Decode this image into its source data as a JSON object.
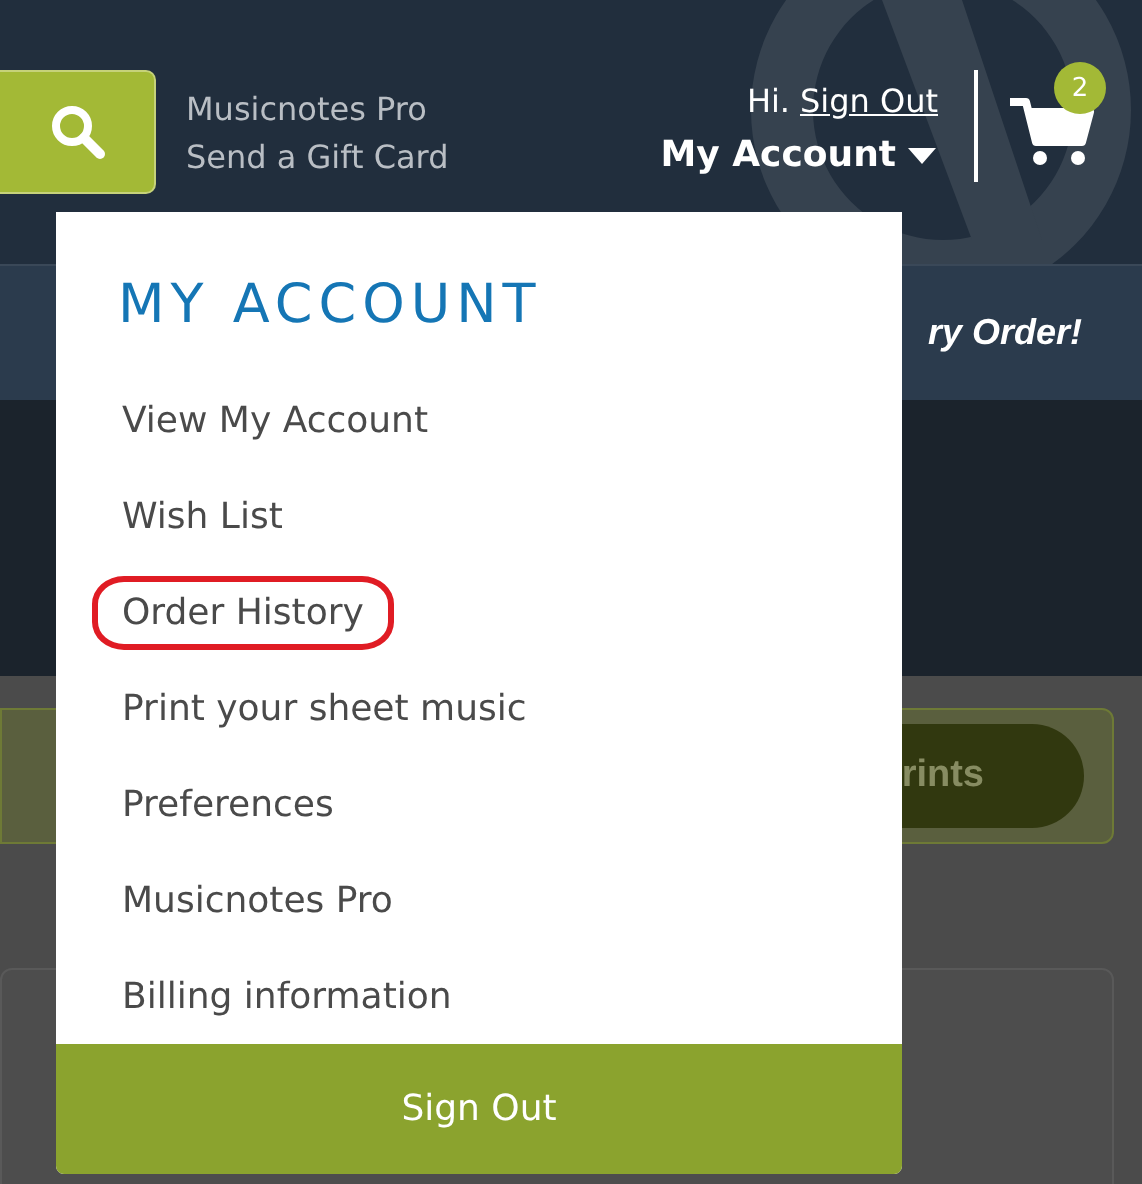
{
  "header": {
    "links": [
      "Musicnotes Pro",
      "Send a Gift Card"
    ],
    "greeting": "Hi.",
    "sign_out_link": "Sign Out",
    "account_menu": {
      "label": "My Account",
      "expanded": true
    },
    "cart": {
      "badge": "2"
    }
  },
  "promo": {
    "text": "ry Order!"
  },
  "banner": {
    "button": "rints"
  },
  "dropdown": {
    "title": "MY ACCOUNT",
    "items": [
      {
        "label": "View My Account",
        "highlighted": false
      },
      {
        "label": "Wish List",
        "highlighted": false
      },
      {
        "label": "Order History",
        "highlighted": true
      },
      {
        "label": "Print your sheet music",
        "highlighted": false
      },
      {
        "label": "Preferences",
        "highlighted": false
      },
      {
        "label": "Musicnotes Pro",
        "highlighted": false
      },
      {
        "label": "Billing information",
        "highlighted": false
      }
    ],
    "button": "Sign Out"
  }
}
